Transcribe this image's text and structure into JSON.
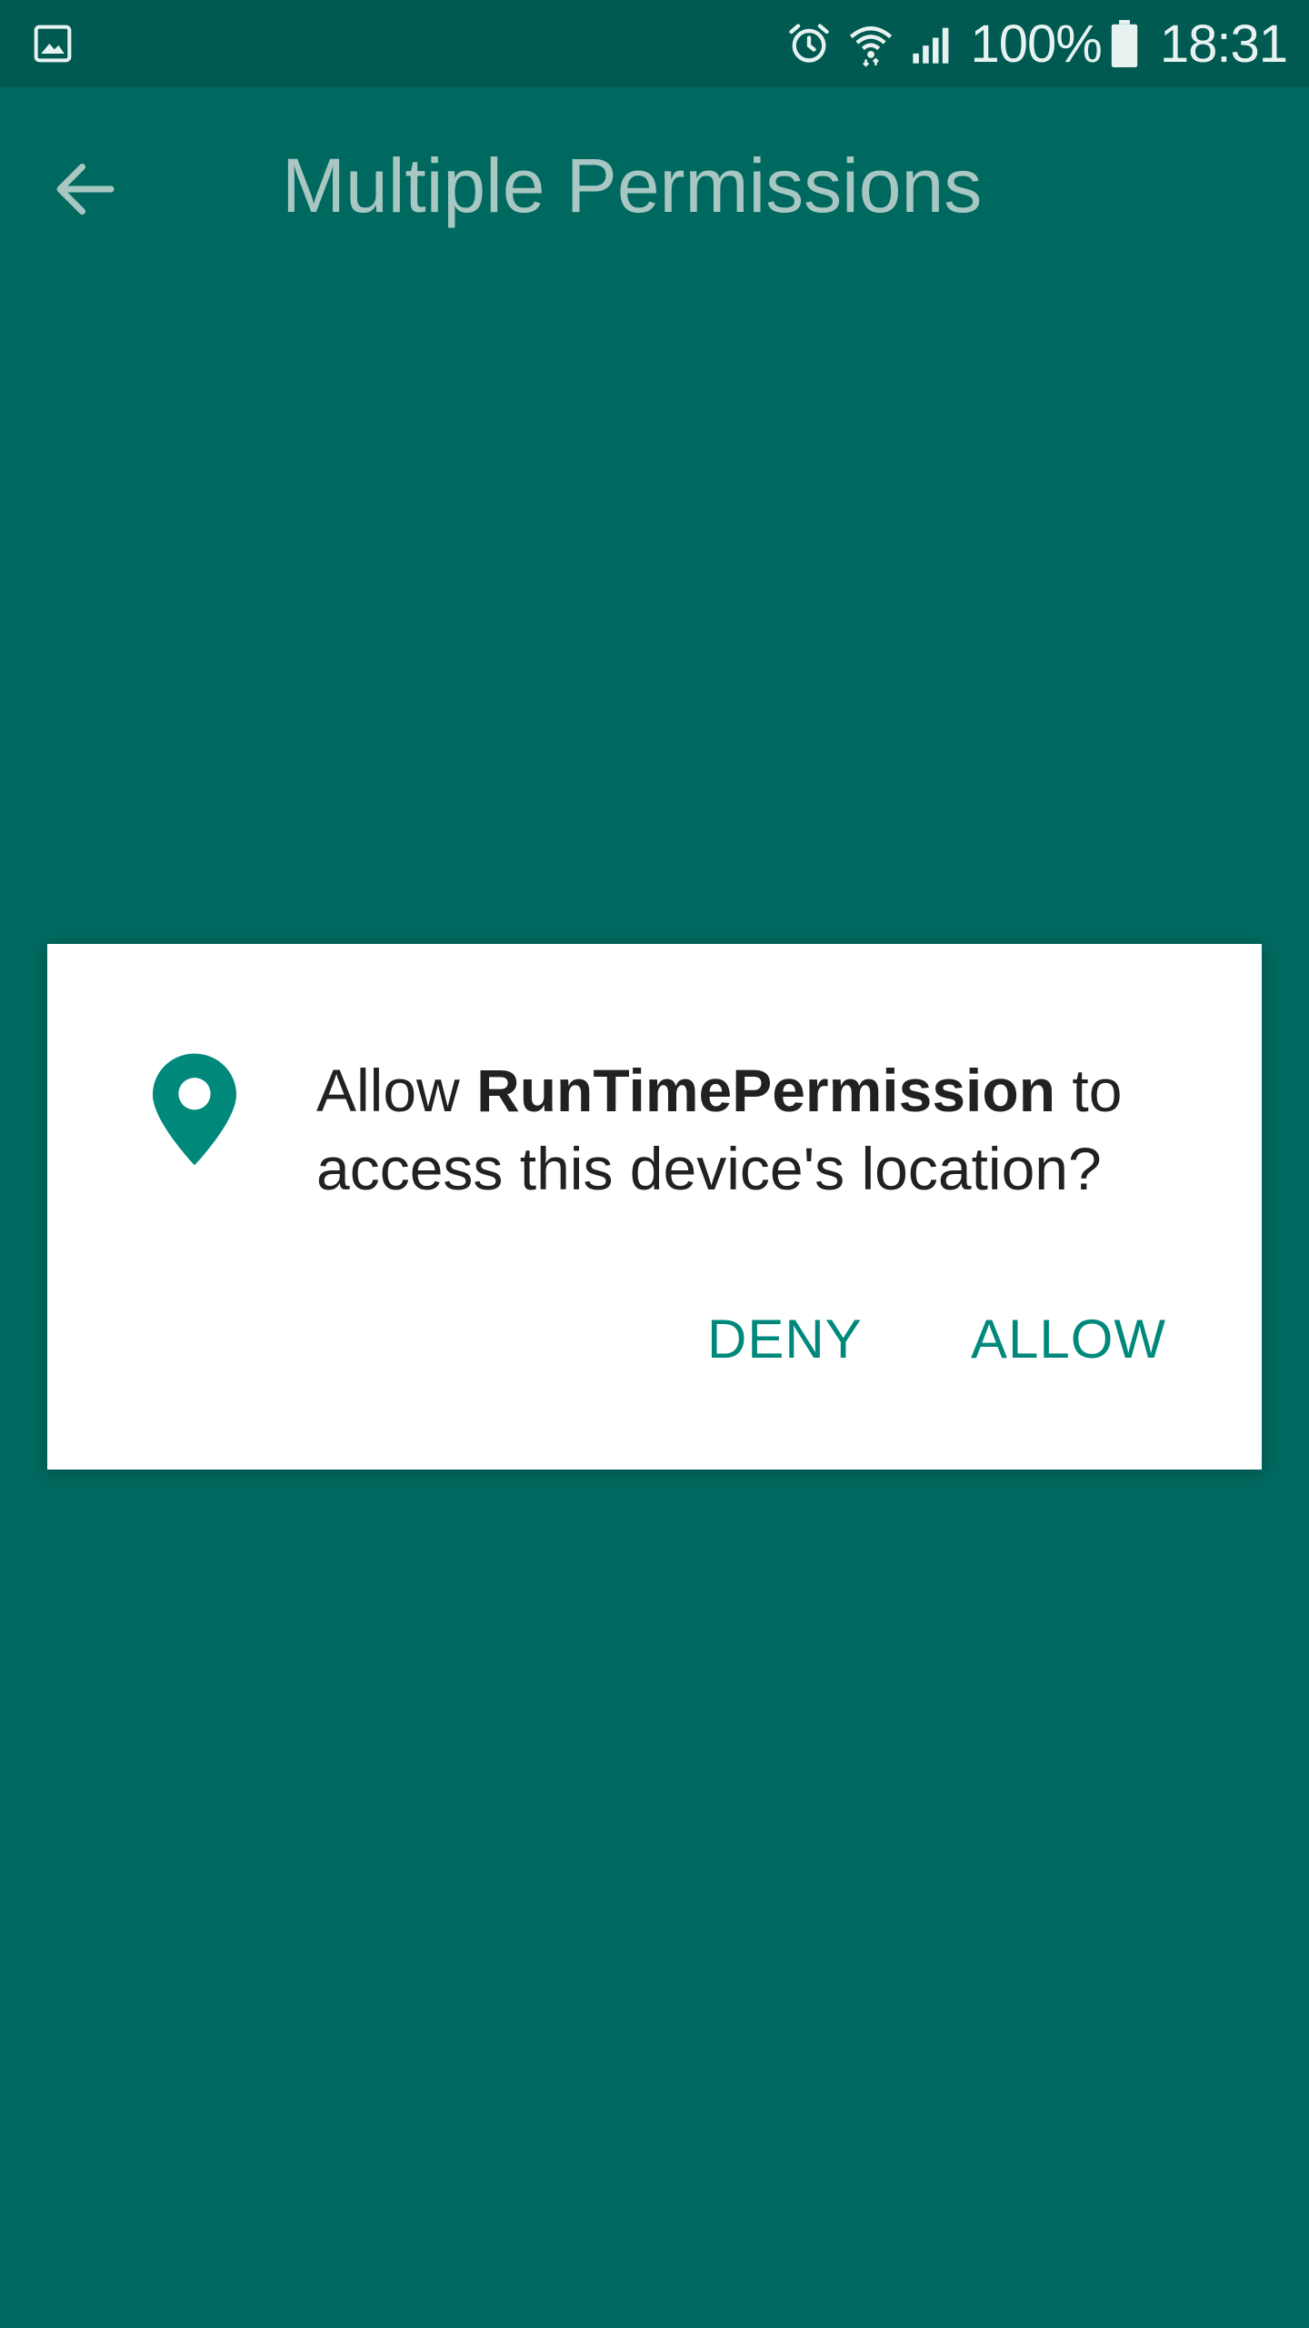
{
  "status_bar": {
    "battery_percent": "100%",
    "time": "18:31",
    "icons": [
      "gallery-icon",
      "alarm-icon",
      "wifi-icon",
      "signal-icon",
      "battery-icon"
    ]
  },
  "app_bar": {
    "title": "Multiple Permissions",
    "back_icon": "arrow-back-icon"
  },
  "dialog": {
    "icon": "location-pin-icon",
    "message_prefix": "Allow ",
    "app_name": "RunTimePermission",
    "message_suffix": " to access this device's location?",
    "deny_label": "DENY",
    "allow_label": "ALLOW"
  },
  "colors": {
    "background": "#00695f",
    "status_bar": "#005a51",
    "accent": "#00897b",
    "title_text": "#a9c7c2"
  }
}
